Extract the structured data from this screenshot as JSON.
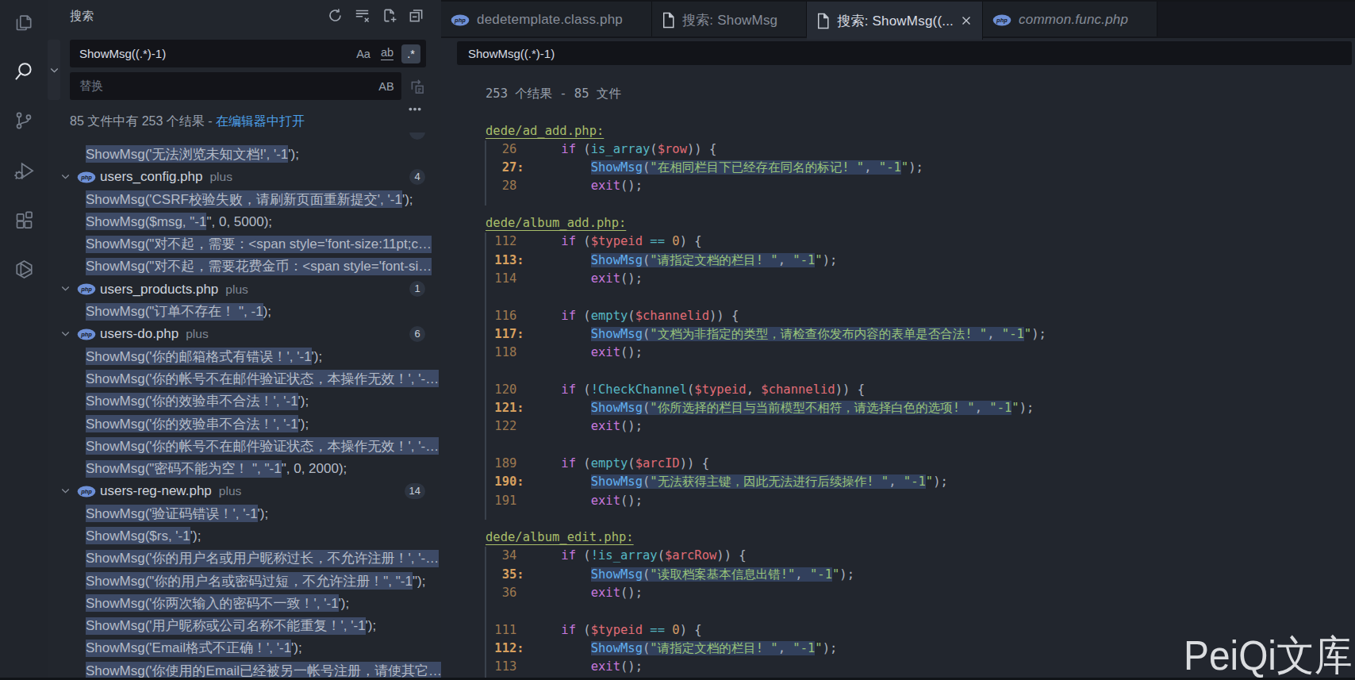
{
  "colors": {
    "accent_link": "#4da0e8",
    "match_highlight_sidebar": "#3d4a66",
    "match_highlight_editor": "#32405c",
    "badge_background": "#2e3541",
    "string_green": "#98c379",
    "keyword_magenta": "#c678dd",
    "function_blue": "#61afef",
    "variable_red": "#e06c75",
    "number_orange": "#d19a66",
    "php_icon_blue": "#6e90d6"
  },
  "activity_bar": {
    "items": [
      {
        "icon": "files-icon",
        "active": false
      },
      {
        "icon": "search-icon",
        "active": true
      },
      {
        "icon": "source-control-icon",
        "active": false
      },
      {
        "icon": "run-debug-icon",
        "active": false
      },
      {
        "icon": "extensions-icon",
        "active": false
      },
      {
        "icon": "package-icon",
        "active": false
      }
    ]
  },
  "sidebar": {
    "title": "搜索",
    "actions": [
      {
        "icon": "refresh-icon"
      },
      {
        "icon": "clear-search-results-icon"
      },
      {
        "icon": "open-new-search-editor-icon"
      },
      {
        "icon": "collapse-all-icon"
      }
    ],
    "search_input": {
      "value": "ShowMsg((.*)-1)",
      "options": [
        {
          "icon": "match-case-icon",
          "glyph": "Aa",
          "active": false
        },
        {
          "icon": "whole-word-icon",
          "glyph": "ab",
          "active": false
        },
        {
          "icon": "regex-icon",
          "glyph": ".*",
          "active": true
        }
      ]
    },
    "replace_input": {
      "placeholder": "替换",
      "options": [
        {
          "icon": "preserve-case-icon",
          "glyph": "AB",
          "active": false
        }
      ]
    },
    "results_message": {
      "text": "85 文件中有 253 个结果 - ",
      "link": "在编辑器中打开"
    },
    "tree": [
      {
        "type": "file",
        "name": "",
        "plus": "",
        "badge": ""
      },
      {
        "type": "match",
        "hl": "ShowMsg('无法浏览未知文档!', '-1",
        "rest": "');"
      },
      {
        "type": "file",
        "name": "users_config.php",
        "plus": "plus",
        "badge": "4"
      },
      {
        "type": "match",
        "hl": "ShowMsg('CSRF校验失败，请刷新页面重新提交', '-1",
        "rest": "');"
      },
      {
        "type": "match",
        "hl": "ShowMsg($msg, \"-1",
        "rest": "\", 0, 5000);"
      },
      {
        "type": "match",
        "hl": "ShowMsg(\"对不起，需要：<span style='font-size:11pt;c…",
        "rest": ""
      },
      {
        "type": "match",
        "hl": "ShowMsg(\"对不起，需要花费金币：<span style='font-si…",
        "rest": ""
      },
      {
        "type": "file",
        "name": "users_products.php",
        "plus": "plus",
        "badge": "1"
      },
      {
        "type": "match",
        "hl": "ShowMsg(\"订单不存在！ \", -1",
        "rest": ");"
      },
      {
        "type": "file",
        "name": "users-do.php",
        "plus": "plus",
        "badge": "6"
      },
      {
        "type": "match",
        "hl": "ShowMsg('你的邮箱格式有错误！', '-1",
        "rest": "');"
      },
      {
        "type": "match",
        "hl": "ShowMsg('你的帐号不在邮件验证状态，本操作无效！', '-…",
        "rest": ""
      },
      {
        "type": "match",
        "hl": "ShowMsg('你的效验串不合法！', '-1",
        "rest": "');"
      },
      {
        "type": "match",
        "hl": "ShowMsg('你的效验串不合法！', '-1",
        "rest": "');"
      },
      {
        "type": "match",
        "hl": "ShowMsg('你的帐号不在邮件验证状态，本操作无效！', '-…",
        "rest": ""
      },
      {
        "type": "match",
        "hl": "ShowMsg(\"密码不能为空！ \", \"-1",
        "rest": "\", 0, 2000);"
      },
      {
        "type": "file",
        "name": "users-reg-new.php",
        "plus": "plus",
        "badge": "14"
      },
      {
        "type": "match",
        "hl": "ShowMsg('验证码错误！', '-1",
        "rest": "');"
      },
      {
        "type": "match",
        "hl": "ShowMsg($rs, '-1",
        "rest": "');"
      },
      {
        "type": "match",
        "hl": "ShowMsg('你的用户名或用户昵称过长，不允许注册！', '-…",
        "rest": ""
      },
      {
        "type": "match",
        "hl": "ShowMsg(\"你的用户名或密码过短，不允许注册！\", \"-1",
        "rest": "\");"
      },
      {
        "type": "match",
        "hl": "ShowMsg('你两次输入的密码不一致！', '-1",
        "rest": "');"
      },
      {
        "type": "match",
        "hl": "ShowMsg('用户昵称或公司名称不能重复！', '-1",
        "rest": "');"
      },
      {
        "type": "match",
        "hl": "ShowMsg('Email格式不正确！', '-1",
        "rest": "');"
      },
      {
        "type": "match",
        "hl": "ShowMsg('你使用的Email已经被另一帐号注册，请使其它…",
        "rest": ""
      }
    ]
  },
  "editor": {
    "tabs": [
      {
        "icon": "php-icon",
        "label": "dedetemplate.class.php",
        "active": false,
        "italic": false,
        "close": false
      },
      {
        "icon": "file-icon",
        "label": "搜索: ShowMsg",
        "active": false,
        "italic": false,
        "close": false
      },
      {
        "icon": "file-icon",
        "label": "搜索: ShowMsg((...",
        "active": true,
        "italic": false,
        "close": true
      },
      {
        "icon": "php-icon",
        "label": "common.func.php",
        "active": false,
        "italic": true,
        "close": false
      }
    ],
    "query": "ShowMsg((.*)-1)",
    "summary": "253 个结果 - 85 文件",
    "sections": [
      {
        "heading": "dede/ad_add.php:",
        "lines": [
          {
            "segs": [
              [
                "ln",
                "  26  "
              ],
              [
                "d",
                "    "
              ],
              [
                "k",
                "if"
              ],
              [
                "d",
                " ("
              ],
              [
                "t",
                "is_array"
              ],
              [
                "d",
                "("
              ],
              [
                "v",
                "$row"
              ],
              [
                "d",
                ")) {"
              ]
            ]
          },
          {
            "segs": [
              [
                "lnm",
                "  27: "
              ],
              [
                "d",
                "        "
              ],
              [
                "f",
                "ShowMsg",
                1
              ],
              [
                "d",
                "(",
                1
              ],
              [
                "s",
                "\"在相同栏目下已经存在同名的标记! \"",
                1
              ],
              [
                "d",
                ", ",
                1
              ],
              [
                "s",
                "\"-1",
                1
              ],
              [
                "s",
                "\""
              ],
              [
                "d",
                ");"
              ]
            ]
          },
          {
            "segs": [
              [
                "ln",
                "  28  "
              ],
              [
                "d",
                "        "
              ],
              [
                "k",
                "exit"
              ],
              [
                "d",
                "();"
              ]
            ]
          }
        ]
      },
      {
        "heading": "dede/album_add.php:",
        "lines": [
          {
            "segs": [
              [
                "ln",
                " 112  "
              ],
              [
                "d",
                "    "
              ],
              [
                "k",
                "if"
              ],
              [
                "d",
                " ("
              ],
              [
                "v",
                "$typeid"
              ],
              [
                "d",
                " "
              ],
              [
                "o",
                "=="
              ],
              [
                "d",
                " "
              ],
              [
                "n",
                "0"
              ],
              [
                "d",
                ") {"
              ]
            ]
          },
          {
            "segs": [
              [
                "lnm",
                " 113: "
              ],
              [
                "d",
                "        "
              ],
              [
                "f",
                "ShowMsg",
                1
              ],
              [
                "d",
                "(",
                1
              ],
              [
                "s",
                "\"请指定文档的栏目! \"",
                1
              ],
              [
                "d",
                ", ",
                1
              ],
              [
                "s",
                "\"-1",
                1
              ],
              [
                "s",
                "\""
              ],
              [
                "d",
                ");"
              ]
            ]
          },
          {
            "segs": [
              [
                "ln",
                " 114  "
              ],
              [
                "d",
                "        "
              ],
              [
                "k",
                "exit"
              ],
              [
                "d",
                "();"
              ]
            ]
          },
          {
            "blank": true
          },
          {
            "segs": [
              [
                "ln",
                " 116  "
              ],
              [
                "d",
                "    "
              ],
              [
                "k",
                "if"
              ],
              [
                "d",
                " ("
              ],
              [
                "t",
                "empty"
              ],
              [
                "d",
                "("
              ],
              [
                "v",
                "$channelid"
              ],
              [
                "d",
                ")) {"
              ]
            ]
          },
          {
            "segs": [
              [
                "lnm",
                " 117: "
              ],
              [
                "d",
                "        "
              ],
              [
                "f",
                "ShowMsg",
                1
              ],
              [
                "d",
                "(",
                1
              ],
              [
                "s",
                "\"文档为非指定的类型，请检查你发布内容的表单是否合法! \"",
                1
              ],
              [
                "d",
                ", ",
                1
              ],
              [
                "s",
                "\"-1",
                1
              ],
              [
                "s",
                "\""
              ],
              [
                "d",
                ");"
              ]
            ]
          },
          {
            "segs": [
              [
                "ln",
                " 118  "
              ],
              [
                "d",
                "        "
              ],
              [
                "k",
                "exit"
              ],
              [
                "d",
                "();"
              ]
            ]
          },
          {
            "blank": true
          },
          {
            "segs": [
              [
                "ln",
                " 120  "
              ],
              [
                "d",
                "    "
              ],
              [
                "k",
                "if"
              ],
              [
                "d",
                " ("
              ],
              [
                "o",
                "!"
              ],
              [
                "t",
                "CheckChannel"
              ],
              [
                "d",
                "("
              ],
              [
                "v",
                "$typeid"
              ],
              [
                "d",
                ", "
              ],
              [
                "v",
                "$channelid"
              ],
              [
                "d",
                ")) {"
              ]
            ]
          },
          {
            "segs": [
              [
                "lnm",
                " 121: "
              ],
              [
                "d",
                "        "
              ],
              [
                "f",
                "ShowMsg",
                1
              ],
              [
                "d",
                "(",
                1
              ],
              [
                "s",
                "\"你所选择的栏目与当前模型不相符，请选择白色的选项! \"",
                1
              ],
              [
                "d",
                ", ",
                1
              ],
              [
                "s",
                "\"-1",
                1
              ],
              [
                "s",
                "\""
              ],
              [
                "d",
                ");"
              ]
            ]
          },
          {
            "segs": [
              [
                "ln",
                " 122  "
              ],
              [
                "d",
                "        "
              ],
              [
                "k",
                "exit"
              ],
              [
                "d",
                "();"
              ]
            ]
          },
          {
            "blank": true
          },
          {
            "segs": [
              [
                "ln",
                " 189  "
              ],
              [
                "d",
                "    "
              ],
              [
                "k",
                "if"
              ],
              [
                "d",
                " ("
              ],
              [
                "t",
                "empty"
              ],
              [
                "d",
                "("
              ],
              [
                "v",
                "$arcID"
              ],
              [
                "d",
                ")) {"
              ]
            ]
          },
          {
            "segs": [
              [
                "lnm",
                " 190: "
              ],
              [
                "d",
                "        "
              ],
              [
                "f",
                "ShowMsg",
                1
              ],
              [
                "d",
                "(",
                1
              ],
              [
                "s",
                "\"无法获得主键，因此无法进行后续操作! \"",
                1
              ],
              [
                "d",
                ", ",
                1
              ],
              [
                "s",
                "\"-1",
                1
              ],
              [
                "s",
                "\""
              ],
              [
                "d",
                ");"
              ]
            ]
          },
          {
            "segs": [
              [
                "ln",
                " 191  "
              ],
              [
                "d",
                "        "
              ],
              [
                "k",
                "exit"
              ],
              [
                "d",
                "();"
              ]
            ]
          }
        ]
      },
      {
        "heading": "dede/album_edit.php:",
        "lines": [
          {
            "segs": [
              [
                "ln",
                "  34  "
              ],
              [
                "d",
                "    "
              ],
              [
                "k",
                "if"
              ],
              [
                "d",
                " ("
              ],
              [
                "o",
                "!"
              ],
              [
                "t",
                "is_array"
              ],
              [
                "d",
                "("
              ],
              [
                "v",
                "$arcRow"
              ],
              [
                "d",
                ")) {"
              ]
            ]
          },
          {
            "segs": [
              [
                "lnm",
                "  35: "
              ],
              [
                "d",
                "        "
              ],
              [
                "f",
                "ShowMsg",
                1
              ],
              [
                "d",
                "(",
                1
              ],
              [
                "s",
                "\"读取档案基本信息出错!\"",
                1
              ],
              [
                "d",
                ", ",
                1
              ],
              [
                "s",
                "\"-1",
                1
              ],
              [
                "s",
                "\""
              ],
              [
                "d",
                ");"
              ]
            ]
          },
          {
            "segs": [
              [
                "ln",
                "  36  "
              ],
              [
                "d",
                "        "
              ],
              [
                "k",
                "exit"
              ],
              [
                "d",
                "();"
              ]
            ]
          },
          {
            "blank": true
          },
          {
            "segs": [
              [
                "ln",
                " 111  "
              ],
              [
                "d",
                "    "
              ],
              [
                "k",
                "if"
              ],
              [
                "d",
                " ("
              ],
              [
                "v",
                "$typeid"
              ],
              [
                "d",
                " "
              ],
              [
                "o",
                "=="
              ],
              [
                "d",
                " "
              ],
              [
                "n",
                "0"
              ],
              [
                "d",
                ") {"
              ]
            ]
          },
          {
            "segs": [
              [
                "lnm",
                " 112: "
              ],
              [
                "d",
                "        "
              ],
              [
                "f",
                "ShowMsg",
                1
              ],
              [
                "d",
                "(",
                1
              ],
              [
                "s",
                "\"请指定文档的栏目! \"",
                1
              ],
              [
                "d",
                ", ",
                1
              ],
              [
                "s",
                "\"-1",
                1
              ],
              [
                "s",
                "\""
              ],
              [
                "d",
                ");"
              ]
            ]
          },
          {
            "segs": [
              [
                "ln",
                " 113  "
              ],
              [
                "d",
                "        "
              ],
              [
                "k",
                "exit"
              ],
              [
                "d",
                "();"
              ]
            ]
          }
        ]
      }
    ]
  },
  "watermark": "PeiQi文库"
}
